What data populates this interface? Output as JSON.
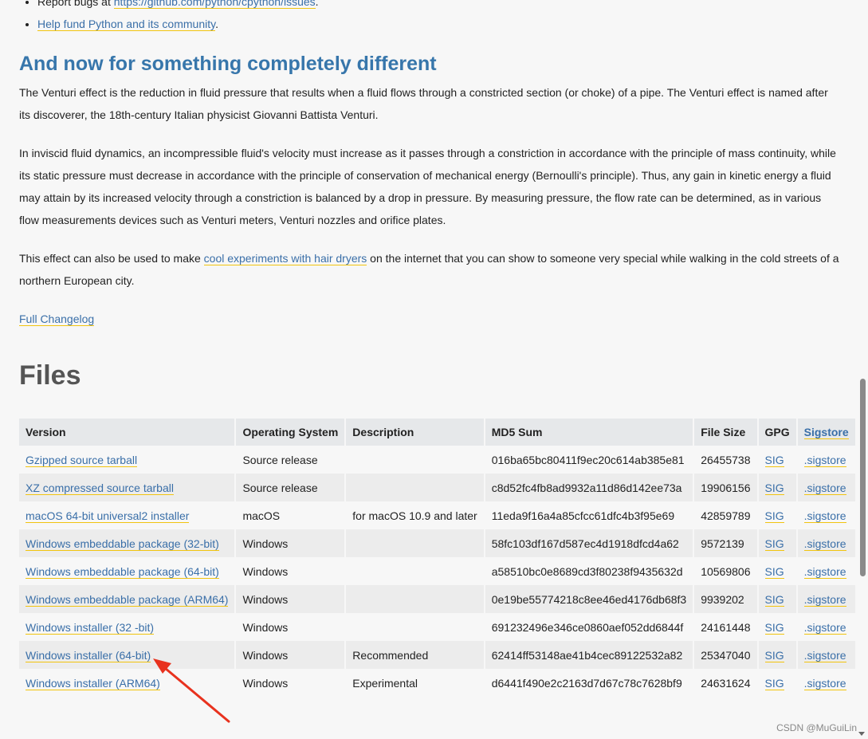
{
  "top_list": {
    "bug_prefix": "Report bugs at ",
    "bug_link": "https://github.com/python/cpython/issues",
    "bug_suffix": ".",
    "fund_link": "Help fund Python and its community",
    "fund_suffix": "."
  },
  "section": {
    "title": "And now for something completely different",
    "para1": "The Venturi effect is the reduction in fluid pressure that results when a fluid flows through a constricted section (or choke) of a pipe. The Venturi effect is named after its discoverer, the 18th-century Italian physicist Giovanni Battista Venturi.",
    "para2": "In inviscid fluid dynamics, an incompressible fluid's velocity must increase as it passes through a constriction in accordance with the principle of mass continuity, while its static pressure must decrease in accordance with the principle of conservation of mechanical energy (Bernoulli's principle). Thus, any gain in kinetic energy a fluid may attain by its increased velocity through a constriction is balanced by a drop in pressure. By measuring pressure, the flow rate can be determined, as in various flow measurements devices such as Venturi meters, Venturi nozzles and orifice plates.",
    "para3_prefix": "This effect can also be used to make ",
    "para3_link": "cool experiments with hair dryers",
    "para3_suffix": " on the internet that you can show to someone very special while walking in the cold streets of a northern European city.",
    "changelog_link": "Full Changelog"
  },
  "files": {
    "title": "Files",
    "headers": [
      "Version",
      "Operating System",
      "Description",
      "MD5 Sum",
      "File Size",
      "GPG",
      "Sigstore"
    ],
    "rows": [
      {
        "version": "Gzipped source tarball",
        "os": "Source release",
        "desc": "",
        "md5": "016ba65bc80411f9ec20c614ab385e81",
        "size": "26455738",
        "gpg": "SIG",
        "sigstore": ".sigstore"
      },
      {
        "version": "XZ compressed source tarball",
        "os": "Source release",
        "desc": "",
        "md5": "c8d52fc4fb8ad9932a11d86d142ee73a",
        "size": "19906156",
        "gpg": "SIG",
        "sigstore": ".sigstore"
      },
      {
        "version": "macOS 64-bit universal2 installer",
        "os": "macOS",
        "desc": "for macOS 10.9 and later",
        "md5": "11eda9f16a4a85cfcc61dfc4b3f95e69",
        "size": "42859789",
        "gpg": "SIG",
        "sigstore": ".sigstore"
      },
      {
        "version": "Windows embeddable package (32-bit)",
        "os": "Windows",
        "desc": "",
        "md5": "58fc103df167d587ec4d1918dfcd4a62",
        "size": "9572139",
        "gpg": "SIG",
        "sigstore": ".sigstore"
      },
      {
        "version": "Windows embeddable package (64-bit)",
        "os": "Windows",
        "desc": "",
        "md5": "a58510bc0e8689cd3f80238f9435632d",
        "size": "10569806",
        "gpg": "SIG",
        "sigstore": ".sigstore"
      },
      {
        "version": "Windows embeddable package (ARM64)",
        "os": "Windows",
        "desc": "",
        "md5": "0e19be55774218c8ee46ed4176db68f3",
        "size": "9939202",
        "gpg": "SIG",
        "sigstore": ".sigstore"
      },
      {
        "version": "Windows installer (32 -bit)",
        "os": "Windows",
        "desc": "",
        "md5": "691232496e346ce0860aef052dd6844f",
        "size": "24161448",
        "gpg": "SIG",
        "sigstore": ".sigstore"
      },
      {
        "version": "Windows installer (64-bit)",
        "os": "Windows",
        "desc": "Recommended",
        "md5": "62414ff53148ae41b4cec89122532a82",
        "size": "25347040",
        "gpg": "SIG",
        "sigstore": ".sigstore"
      },
      {
        "version": "Windows installer (ARM64)",
        "os": "Windows",
        "desc": "Experimental",
        "md5": "d6441f490e2c2163d7d67c78c7628bf9",
        "size": "24631624",
        "gpg": "SIG",
        "sigstore": ".sigstore"
      }
    ]
  },
  "watermark": "CSDN @MuGuiLin",
  "colors": {
    "link": "#3a6fa8",
    "link_underline": "#f1c40f",
    "section_title": "#3776ab",
    "arrow": "#e8321e"
  }
}
